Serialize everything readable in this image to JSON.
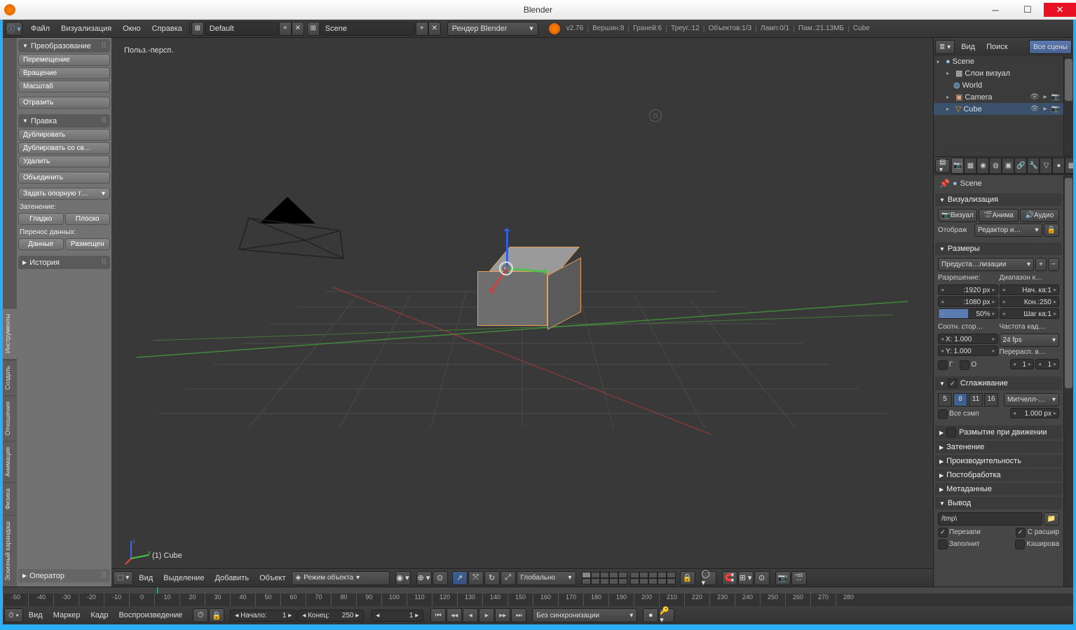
{
  "window": {
    "title": "Blender"
  },
  "topbar": {
    "menus": [
      "Файл",
      "Визуализация",
      "Окно",
      "Справка"
    ],
    "layout_name": "Default",
    "scene_name": "Scene",
    "render_engine": "Рендер Blender",
    "version": "v2.76",
    "stats": {
      "verts": "Вершин:8",
      "faces": "Граней:6",
      "tris": "Треуг.:12",
      "objects": "Объектов:1/3",
      "lamps": "Ламп:0/1",
      "mem": "Пам.:21.13МБ",
      "active": "Cube"
    }
  },
  "left_panel": {
    "tabs": [
      "Инструменты",
      "Создать",
      "Отношения",
      "Анимация",
      "Физика",
      "Эскизный карандаш"
    ],
    "transform": {
      "title": "Преобразование",
      "translate": "Перемещение",
      "rotate": "Вращение",
      "scale": "Масштаб",
      "mirror": "Отразить"
    },
    "edit": {
      "title": "Правка",
      "duplicate": "Дублировать",
      "duplicate_linked": "Дублировать со св…",
      "delete": "Удалить",
      "join": "Объединить",
      "set_origin": "Задать опорную т…",
      "shading_label": "Затенение:",
      "smooth": "Гладко",
      "flat": "Плоско",
      "datatransfer_label": "Перенос данных:",
      "data": "Данные",
      "layout": "Размещен"
    },
    "history": {
      "title": "История"
    },
    "operator": {
      "title": "Оператор"
    }
  },
  "viewport": {
    "top_left": "Польз.-персп.",
    "bottom_left": "(1) Cube",
    "header": {
      "menus": [
        "Вид",
        "Выделение",
        "Добавить",
        "Объект"
      ],
      "mode": "Режим объекта",
      "orientation": "Глобально"
    }
  },
  "outliner": {
    "menus": [
      "Вид",
      "Поиск"
    ],
    "filter_btn": "Все сцены",
    "items": [
      {
        "indent": 0,
        "name": "Scene",
        "icon": "scene"
      },
      {
        "indent": 1,
        "name": "Слои визуал",
        "icon": "layers",
        "expandable": true
      },
      {
        "indent": 1,
        "name": "World",
        "icon": "world"
      },
      {
        "indent": 1,
        "name": "Camera",
        "icon": "camera",
        "expandable": true,
        "restrict": true
      },
      {
        "indent": 1,
        "name": "Cube",
        "icon": "mesh",
        "expandable": true,
        "restrict": true,
        "selected": true
      },
      {
        "indent": 1,
        "name": "",
        "icon": "lamp",
        "expandable": true,
        "restrict": true
      }
    ]
  },
  "properties": {
    "crumb": "Scene",
    "render": {
      "title": "Визуализация",
      "btn_render": "Визуал",
      "btn_anim": "Анима",
      "btn_audio": "Аудио",
      "display_label": "Отображ",
      "display_value": "Редактор и…"
    },
    "dimensions": {
      "title": "Размеры",
      "presets": "Предуста…лизации",
      "res_label": "Разрешение:",
      "range_label": "Диапазон к…",
      "res_x": ":1920 px",
      "res_y": ":1080 px",
      "res_pct": "50%",
      "start": "Нач. ка:1",
      "end": "Кон.:250",
      "step": "Шаг ка:1",
      "aspect_label": "Соотн. стор…",
      "fps_label": "Частота кад…",
      "aspect_x": "X: 1.000",
      "aspect_y": "Y: 1.000",
      "fps": "24 fps",
      "remap": "Перерасп. в…",
      "border": "Г",
      "crop": "О",
      "old": "1",
      "new": "1"
    },
    "antialias": {
      "title": "Сглаживание",
      "samples": [
        "5",
        "8",
        "11",
        "16"
      ],
      "filter": "Митчелл-…",
      "fullsample": "Все сэмп",
      "size": "1.000 px"
    },
    "panels_collapsed": [
      "Размытие при движении",
      "Затенение",
      "Производительность",
      "Постобработка",
      "Метаданные"
    ],
    "output": {
      "title": "Вывод",
      "path": "/tmp\\",
      "overwrite": "Перезапи",
      "extensions": "С расшир",
      "placeholder": "Заполнит",
      "cache": "Кэширова"
    }
  },
  "timeline": {
    "ticks": [
      -50,
      -40,
      -30,
      -20,
      -10,
      0,
      10,
      20,
      30,
      40,
      50,
      60,
      70,
      80,
      90,
      100,
      110,
      120,
      130,
      140,
      150,
      160,
      170,
      180,
      190,
      200,
      210,
      220,
      230,
      240,
      250,
      260,
      270,
      280
    ],
    "menus": [
      "Вид",
      "Маркер",
      "Кадр",
      "Воспроизведение"
    ],
    "start_label": "Начало:",
    "start": "1",
    "end_label": "Конец:",
    "end": "250",
    "current": "1",
    "sync": "Без синхронизации"
  }
}
